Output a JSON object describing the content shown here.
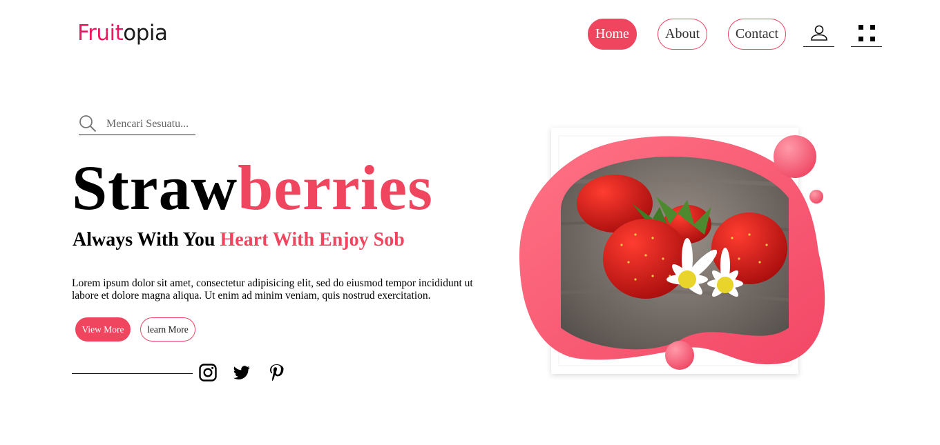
{
  "brand": {
    "part1": "Fruit",
    "part2": "opia"
  },
  "nav": {
    "home": "Home",
    "about": "About",
    "contact": "Contact",
    "user_icon": "user-icon",
    "menu_icon": "grid-menu-icon"
  },
  "search": {
    "placeholder": "Mencari Sesuatu...",
    "icon": "search-icon"
  },
  "hero": {
    "title_part1": "Straw",
    "title_part2": "berries",
    "subtitle_part1": "Always With You ",
    "subtitle_part2": "Heart With Enjoy Sob",
    "description": "Lorem ipsum dolor sit amet, consectetur adipisicing elit, sed do eiusmod tempor incididunt ut labore et dolore magna aliqua. Ut enim ad minim veniam, quis nostrud exercitation."
  },
  "buttons": {
    "view_more": "View More",
    "learn_more": "learn More"
  },
  "social": [
    "instagram-icon",
    "twitter-icon",
    "pinterest-icon"
  ],
  "colors": {
    "accent": "#f0455f",
    "logo_pink": "#ee1862",
    "text": "#000000"
  }
}
